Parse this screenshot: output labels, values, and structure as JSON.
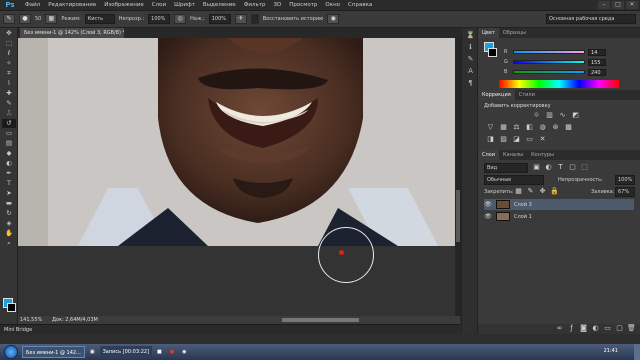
{
  "app": {
    "logo": "Ps"
  },
  "menu": [
    "Файл",
    "Редактирование",
    "Изображение",
    "Слои",
    "Шрифт",
    "Выделение",
    "Фильтр",
    "3D",
    "Просмотр",
    "Окно",
    "Справка"
  ],
  "window_controls": [
    "–",
    "□",
    "✕"
  ],
  "options": {
    "mode_label": "Режим:",
    "mode_value": "Кисть",
    "opacity_label": "Непрозр.:",
    "opacity_value": "100%",
    "flow_label": "Наж.:",
    "flow_value": "100%",
    "history_label": "Восстановить историю",
    "brush_size": "50",
    "workspace": "Основная рабочая среда"
  },
  "document": {
    "tab_title": "Без имени-1 @ 142% (Слой 3, RGB/8) *",
    "zoom": "141,55%",
    "doc_size": "Док: 2,64M/4,03M",
    "mini_bridge": "Mini Bridge"
  },
  "color_panel": {
    "tabs": [
      "Цвет",
      "Образцы"
    ],
    "rows": [
      {
        "label": "R",
        "value": "14"
      },
      {
        "label": "G",
        "value": "155"
      },
      {
        "label": "B",
        "value": "240"
      }
    ],
    "fg_color": "#1e9fe0"
  },
  "adjustments_panel": {
    "tabs": [
      "Коррекция",
      "Стили"
    ],
    "heading": "Добавить корректировку",
    "row1_icons": [
      "brightness-icon",
      "levels-icon",
      "curves-icon",
      "exposure-icon"
    ],
    "row2_icons": [
      "vibrance-icon",
      "hue-icon",
      "color-balance-icon",
      "bw-icon",
      "photo-filter-icon",
      "channel-mixer-icon",
      "lookup-icon"
    ],
    "row3_icons": [
      "invert-icon",
      "posterize-icon",
      "threshold-icon",
      "gradient-map-icon",
      "selective-color-icon"
    ]
  },
  "layers_panel": {
    "tabs": [
      "Слои",
      "Каналы",
      "Контуры"
    ],
    "filter": "Вид",
    "blend_mode": "Обычные",
    "opacity_label": "Непрозрачность:",
    "opacity_value": "100%",
    "lock_label": "Закрепить:",
    "fill_label": "Заливка:",
    "fill_value": "67%",
    "layers": [
      {
        "name": "Слой 3",
        "selected": true
      },
      {
        "name": "Слой 1",
        "selected": false
      }
    ]
  },
  "taskbar": {
    "tasks": [
      "Без имени-1 @ 142...",
      "Запись [00:03:22]"
    ],
    "clock": "21:41"
  }
}
